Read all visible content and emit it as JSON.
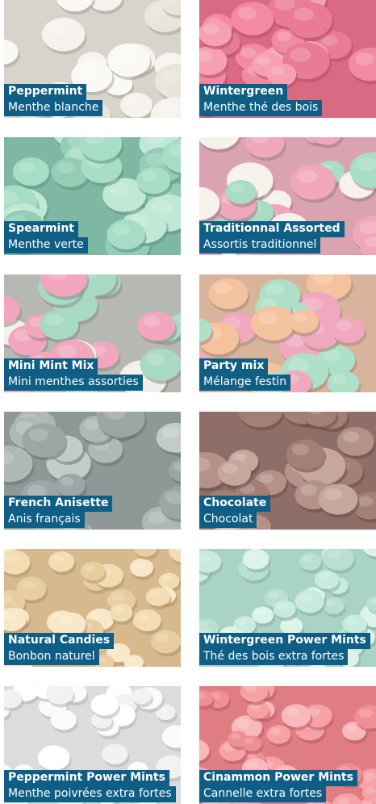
{
  "products": [
    {
      "name_en": "Peppermint",
      "name_fr": "Menthe blanche",
      "base": "#d8d4cc",
      "c1": "#f6f3ee",
      "c2": "#e9e4dc",
      "c3": "#fbf9f5",
      "shadow": "#a8a298"
    },
    {
      "name_en": "Wintergreen",
      "name_fr": "Menthe thé des bois",
      "base": "#d86a83",
      "c1": "#f28aa2",
      "c2": "#e97b95",
      "c3": "#f5a0b3",
      "shadow": "#b24e66"
    },
    {
      "name_en": "Spearmint",
      "name_fr": "Menthe verte",
      "base": "#7fb8a2",
      "c1": "#a7dcc6",
      "c2": "#93cdb6",
      "c3": "#bfe8d6",
      "shadow": "#5f937f"
    },
    {
      "name_en": "Traditionnal Assorted",
      "name_fr": "Assortis traditionnel",
      "base": "#d9a3b2",
      "c1": "#f0a6bb",
      "c2": "#a8dcc4",
      "c3": "#f6f1ea",
      "shadow": "#9f7b86"
    },
    {
      "name_en": "Mini Mint Mix",
      "name_fr": "Mini menthes assorties",
      "base": "#b5b8b3",
      "c1": "#f2a6bd",
      "c2": "#a8d9c2",
      "c3": "#f2efe9",
      "shadow": "#888b86"
    },
    {
      "name_en": "Party mix",
      "name_fr": "Mélange festin",
      "base": "#d7b49b",
      "c1": "#f5c29e",
      "c2": "#f0a8bf",
      "c3": "#aee0c7",
      "shadow": "#a58a76"
    },
    {
      "name_en": "French Anisette",
      "name_fr": "Anis français",
      "base": "#8e9896",
      "c1": "#aeb8b6",
      "c2": "#9ca6a4",
      "c3": "#c2cbc9",
      "shadow": "#6c7573"
    },
    {
      "name_en": "Chocolate",
      "name_fr": "Chocolat",
      "base": "#8e6e66",
      "c1": "#b59289",
      "c2": "#a37f76",
      "c3": "#c7a69d",
      "shadow": "#6a4f49"
    },
    {
      "name_en": "Natural Candies",
      "name_fr": "Bonbon naturel",
      "base": "#d7b98e",
      "c1": "#f2dcb3",
      "c2": "#e8cda0",
      "c3": "#f7e8c9",
      "shadow": "#b0946c"
    },
    {
      "name_en": "Wintergreen Power Mints",
      "name_fr": "Thé des bois extra fortes",
      "base": "#a9d3c4",
      "c1": "#c9ebde",
      "c2": "#b7e0d1",
      "c3": "#dcf3ea",
      "shadow": "#86ae9f"
    },
    {
      "name_en": "Peppermint Power Mints",
      "name_fr": "Menthe poivrées extra fortes",
      "base": "#dcdcdc",
      "c1": "#ffffff",
      "c2": "#f1f1f1",
      "c3": "#fafafa",
      "shadow": "#b4b4b4"
    },
    {
      "name_en": "Cinammon Power Mints",
      "name_fr": "Cannelle extra fortes",
      "base": "#df7d82",
      "c1": "#f6a1a6",
      "c2": "#ee8f95",
      "c3": "#f9b8bb",
      "shadow": "#b85c61"
    }
  ]
}
